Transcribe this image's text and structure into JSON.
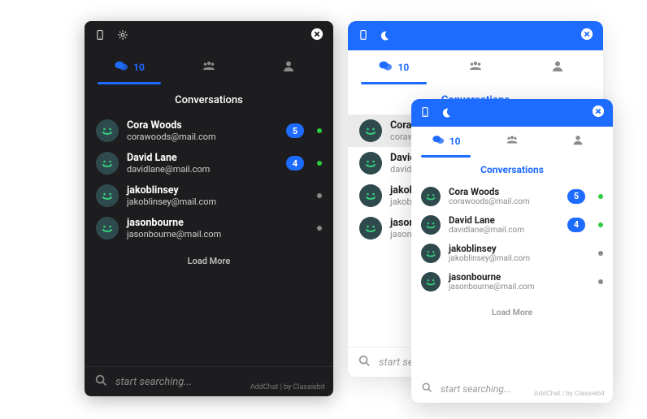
{
  "colors": {
    "accent": "#1e6bff",
    "status_online": "#2ecc40",
    "status_idle": "#8a8a8a"
  },
  "tabs": {
    "chat_badge": "10",
    "groups_label": "",
    "account_label": ""
  },
  "section_title": "Conversations",
  "load_more": "Load More",
  "search_placeholder": "start searching...",
  "footer_text": "AddChat | by Classiebit",
  "conversations": [
    {
      "name": "Cora Woods",
      "email": "corawoods@mail.com",
      "unread": "5",
      "online": true
    },
    {
      "name": "David Lane",
      "email": "davidlane@mail.com",
      "unread": "4",
      "online": true
    },
    {
      "name": "jakoblinsey",
      "email": "jakoblinsey@mail.com",
      "unread": "",
      "online": false
    },
    {
      "name": "jasonbourne",
      "email": "jasonbourne@mail.com",
      "unread": "",
      "online": false
    }
  ]
}
